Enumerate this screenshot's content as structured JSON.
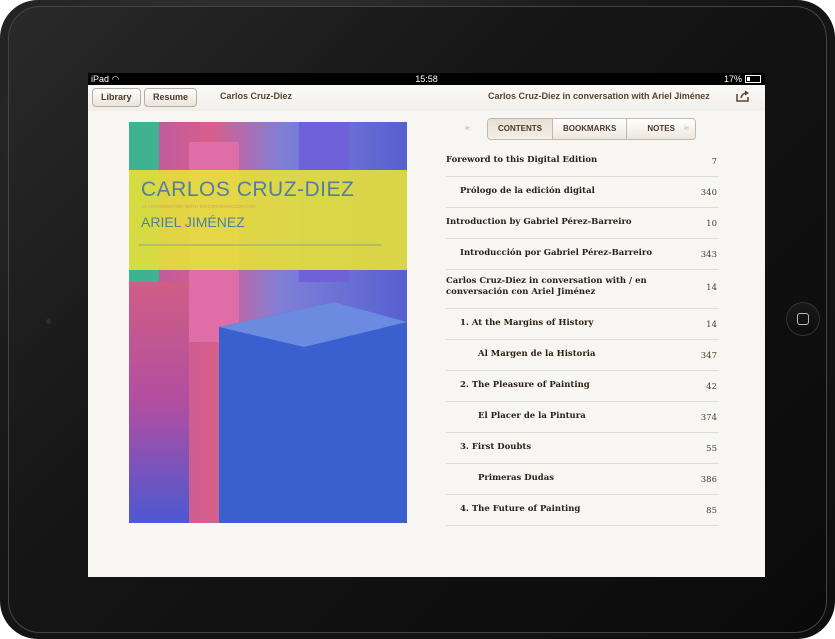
{
  "status": {
    "device": "iPad",
    "time": "15:58",
    "battery": "17%"
  },
  "toolbar": {
    "library_label": "Library",
    "resume_label": "Resume",
    "book_title": "Carlos Cruz-Diez",
    "chapter_title": "Carlos Cruz-Diez in conversation with Ariel Jiménez"
  },
  "cover": {
    "title": "CARLOS CRUZ-DIEZ",
    "subtitle": "IN CONVERSATION WITH / EN CONVERSACIÓN CON",
    "author": "ARIEL JIMÉNEZ",
    "colors": {
      "yellow": "#e4de3c",
      "title": "#4f7fa6",
      "blue": "#2f57c8"
    }
  },
  "tabs": [
    "CONTENTS",
    "BOOKMARKS",
    "NOTES"
  ],
  "toc": [
    {
      "label": "Foreword to this Digital Edition",
      "page": "7",
      "indent": 0
    },
    {
      "label": "Prólogo de la edición digital",
      "page": "340",
      "indent": 1
    },
    {
      "label": "Introduction by Gabriel Pérez-Barreiro",
      "page": "10",
      "indent": 0
    },
    {
      "label": "Introducción por Gabriel Pérez-Barreiro",
      "page": "343",
      "indent": 1
    },
    {
      "label": "Carlos Cruz-Diez in conversation with / en conversación con Ariel Jiménez",
      "page": "14",
      "indent": 0
    },
    {
      "label": "1. At the Margins of History",
      "page": "14",
      "indent": 1
    },
    {
      "label": "Al Margen de la Historia",
      "page": "347",
      "indent": 2
    },
    {
      "label": "2. The Pleasure of Painting",
      "page": "42",
      "indent": 1
    },
    {
      "label": "El Placer de la Pintura",
      "page": "374",
      "indent": 2
    },
    {
      "label": "3. First Doubts",
      "page": "55",
      "indent": 1
    },
    {
      "label": "Primeras Dudas",
      "page": "386",
      "indent": 2
    },
    {
      "label": "4. The Future of Painting",
      "page": "85",
      "indent": 1
    }
  ]
}
